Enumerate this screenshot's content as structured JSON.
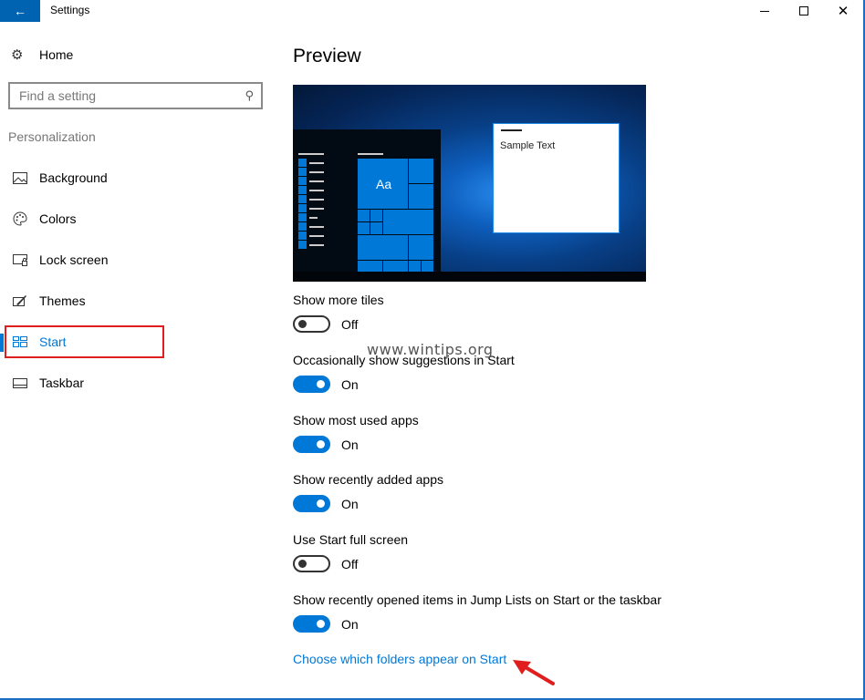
{
  "window": {
    "title": "Settings",
    "back_icon": "arrow-left-icon",
    "controls": {
      "minimize": "minimize-icon",
      "maximize": "maximize-icon",
      "close": "close-icon"
    }
  },
  "sidebar": {
    "home": {
      "label": "Home",
      "icon": "gear-icon"
    },
    "search": {
      "placeholder": "Find a setting",
      "value": "",
      "icon": "search-icon"
    },
    "section_label": "Personalization",
    "items": [
      {
        "label": "Background",
        "icon": "picture-icon",
        "active": false
      },
      {
        "label": "Colors",
        "icon": "palette-icon",
        "active": false
      },
      {
        "label": "Lock screen",
        "icon": "lock-screen-icon",
        "active": false
      },
      {
        "label": "Themes",
        "icon": "themes-icon",
        "active": false
      },
      {
        "label": "Start",
        "icon": "start-tiles-icon",
        "active": true
      },
      {
        "label": "Taskbar",
        "icon": "taskbar-icon",
        "active": false
      }
    ]
  },
  "main": {
    "heading": "Preview",
    "preview": {
      "tile_text": "Aa",
      "window_text": "Sample Text"
    },
    "settings": [
      {
        "label": "Show more tiles",
        "state": "Off",
        "on": false
      },
      {
        "label": "Occasionally show suggestions in Start",
        "state": "On",
        "on": true
      },
      {
        "label": "Show most used apps",
        "state": "On",
        "on": true
      },
      {
        "label": "Show recently added apps",
        "state": "On",
        "on": true
      },
      {
        "label": "Use Start full screen",
        "state": "Off",
        "on": false
      },
      {
        "label": "Show recently opened items in Jump Lists on Start or the taskbar",
        "state": "On",
        "on": true
      }
    ],
    "folders_link": "Choose which folders appear on Start"
  },
  "overlay": {
    "watermark": "www.wintips.org",
    "annotation_color": "#e01e1e"
  },
  "colors": {
    "accent": "#0078d7",
    "titlebar_back": "#0063b1"
  }
}
